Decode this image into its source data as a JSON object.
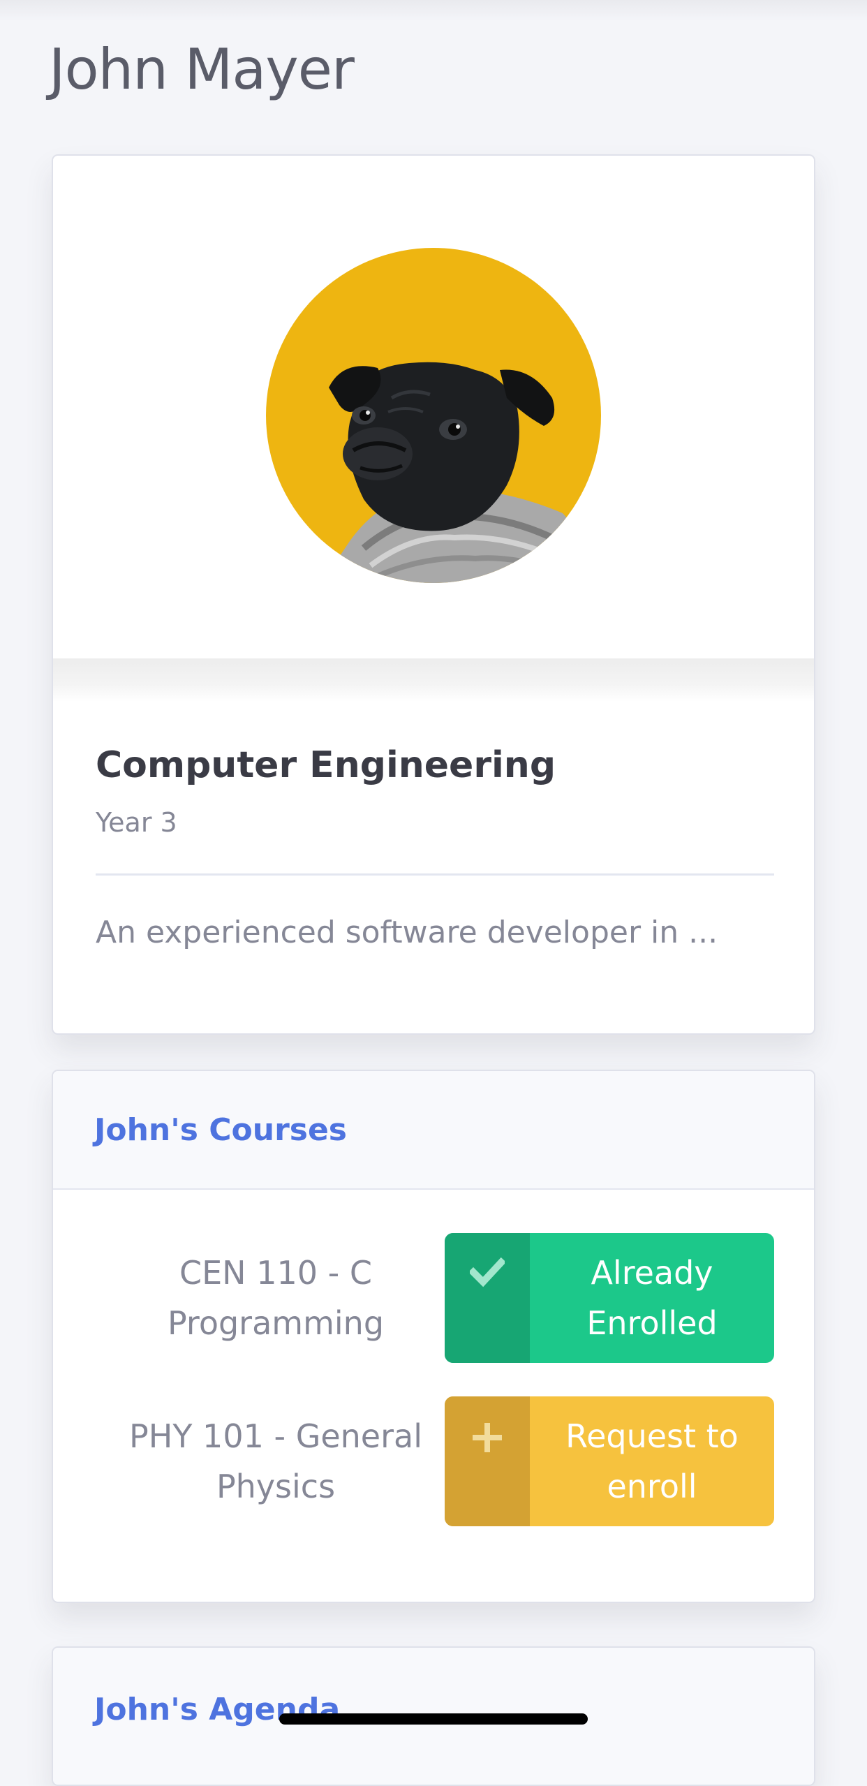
{
  "student": {
    "name": "John Mayer",
    "major": "Computer Engineering",
    "year": "Year 3",
    "bio": "An experienced software developer in ..."
  },
  "courses": {
    "header": "John's Courses",
    "items": [
      {
        "name": "CEN 110 - C Programming",
        "action": "Already Enrolled",
        "icon": "check-icon",
        "status": "enrolled"
      },
      {
        "name": "PHY 101 - General Physics",
        "action": "Request to enroll",
        "icon": "plus-icon",
        "status": "not-enrolled"
      }
    ]
  },
  "agenda": {
    "header": "John's Agenda"
  },
  "colors": {
    "primary": "#4e73df",
    "success": "#1cc88a",
    "warning": "#f6c23e",
    "avatar_background": "#eeb511"
  }
}
